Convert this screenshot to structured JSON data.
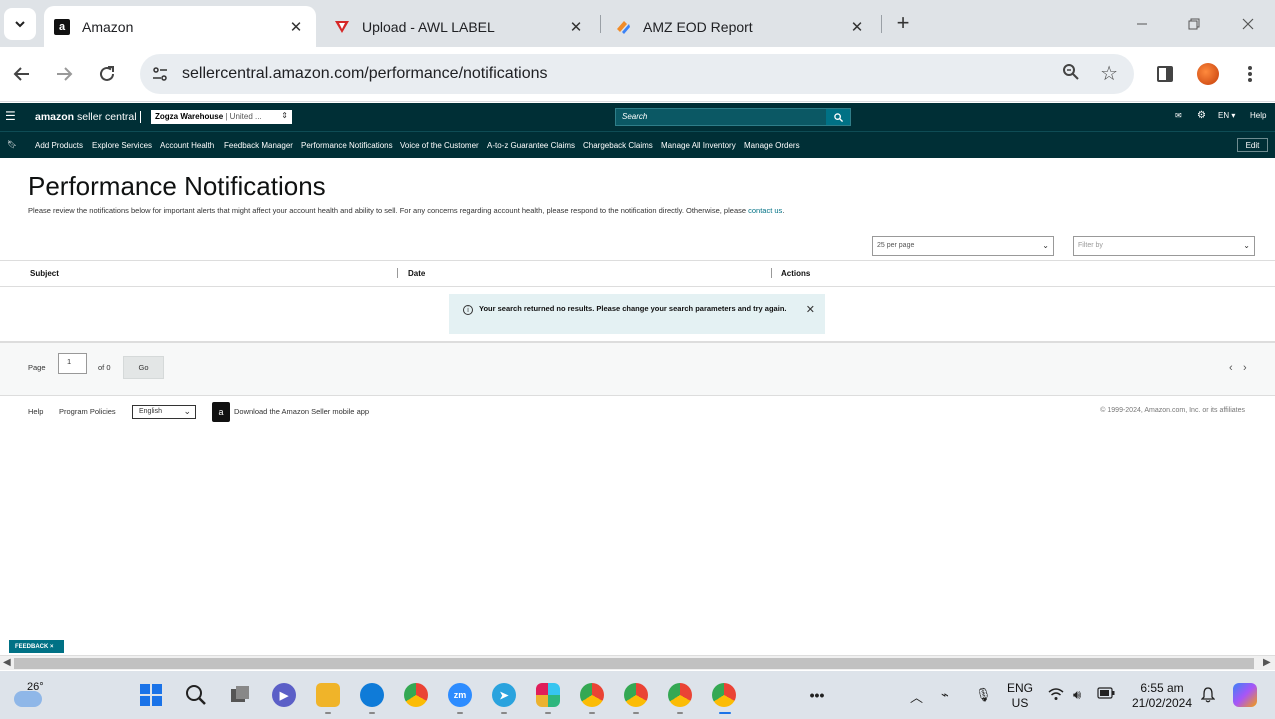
{
  "browser": {
    "tabs": [
      {
        "title": "Amazon",
        "active": true
      },
      {
        "title": "Upload - AWL LABEL",
        "active": false
      },
      {
        "title": "AMZ EOD Report",
        "active": false
      }
    ],
    "url": "sellercentral.amazon.com/performance/notifications"
  },
  "header": {
    "logo_bold": "amazon",
    "logo_rest": " seller central",
    "store_name": "Zogza Warehouse",
    "store_region": " | United ...",
    "search_placeholder": "Search",
    "lang": "EN",
    "help": "Help",
    "edit": "Edit"
  },
  "nav": {
    "items": [
      "Add Products",
      "Explore Services",
      "Account Health",
      "Feedback Manager",
      "Performance Notifications",
      "Voice of the Customer",
      "A-to-z Guarantee Claims",
      "Chargeback Claims",
      "Manage All Inventory",
      "Manage Orders"
    ]
  },
  "main": {
    "title": "Performance Notifications",
    "description": "Please review the notifications below for important alerts that might affect your account health and ability to sell. For any concerns regarding account health, please respond to the notification directly. Otherwise, please ",
    "contact_link": "contact us",
    "description_end": ".",
    "per_page": "25 per page",
    "filter_placeholder": "Filter by",
    "columns": [
      "Subject",
      "Date",
      "Actions"
    ],
    "alert": "Your search returned no results. Please change your search parameters and try again.",
    "pager": {
      "page_label": "Page",
      "page_value": "1",
      "of_label": "of 0",
      "go": "Go"
    }
  },
  "footer": {
    "help": "Help",
    "program_policies": "Program Policies",
    "language": "English",
    "app_text": "Download the Amazon Seller mobile app",
    "copyright": "© 1999-2024, Amazon.com, Inc. or its affiliates"
  },
  "feedback": "FEEDBACK ×",
  "taskbar": {
    "temperature": "26°",
    "lang_top": "ENG",
    "lang_bottom": "US",
    "time": "6:55 am",
    "date": "21/02/2024"
  }
}
